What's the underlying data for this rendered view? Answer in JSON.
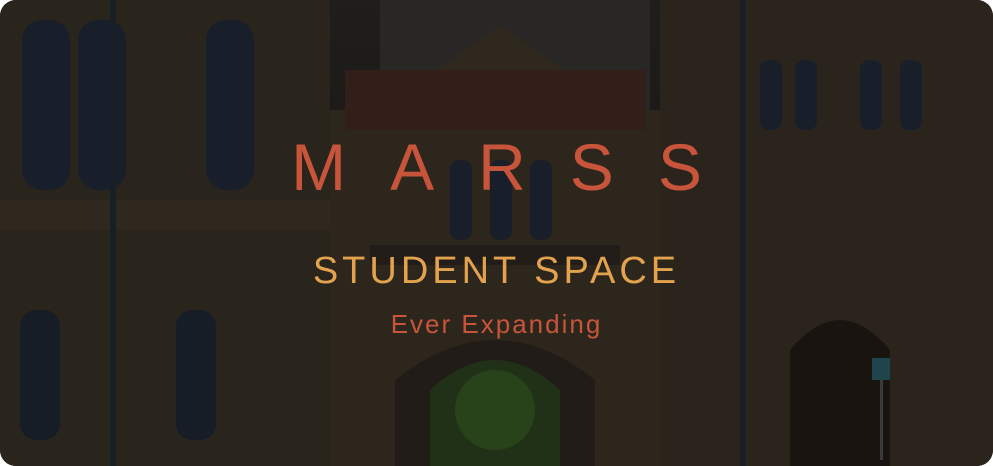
{
  "hero": {
    "title": "MARSS",
    "subtitle": "STUDENT SPACE",
    "tagline": "Ever Expanding",
    "background": "university-building-photo"
  },
  "colors": {
    "title": "#c8553b",
    "subtitle": "#e2a24e",
    "tagline": "#c8553b"
  }
}
